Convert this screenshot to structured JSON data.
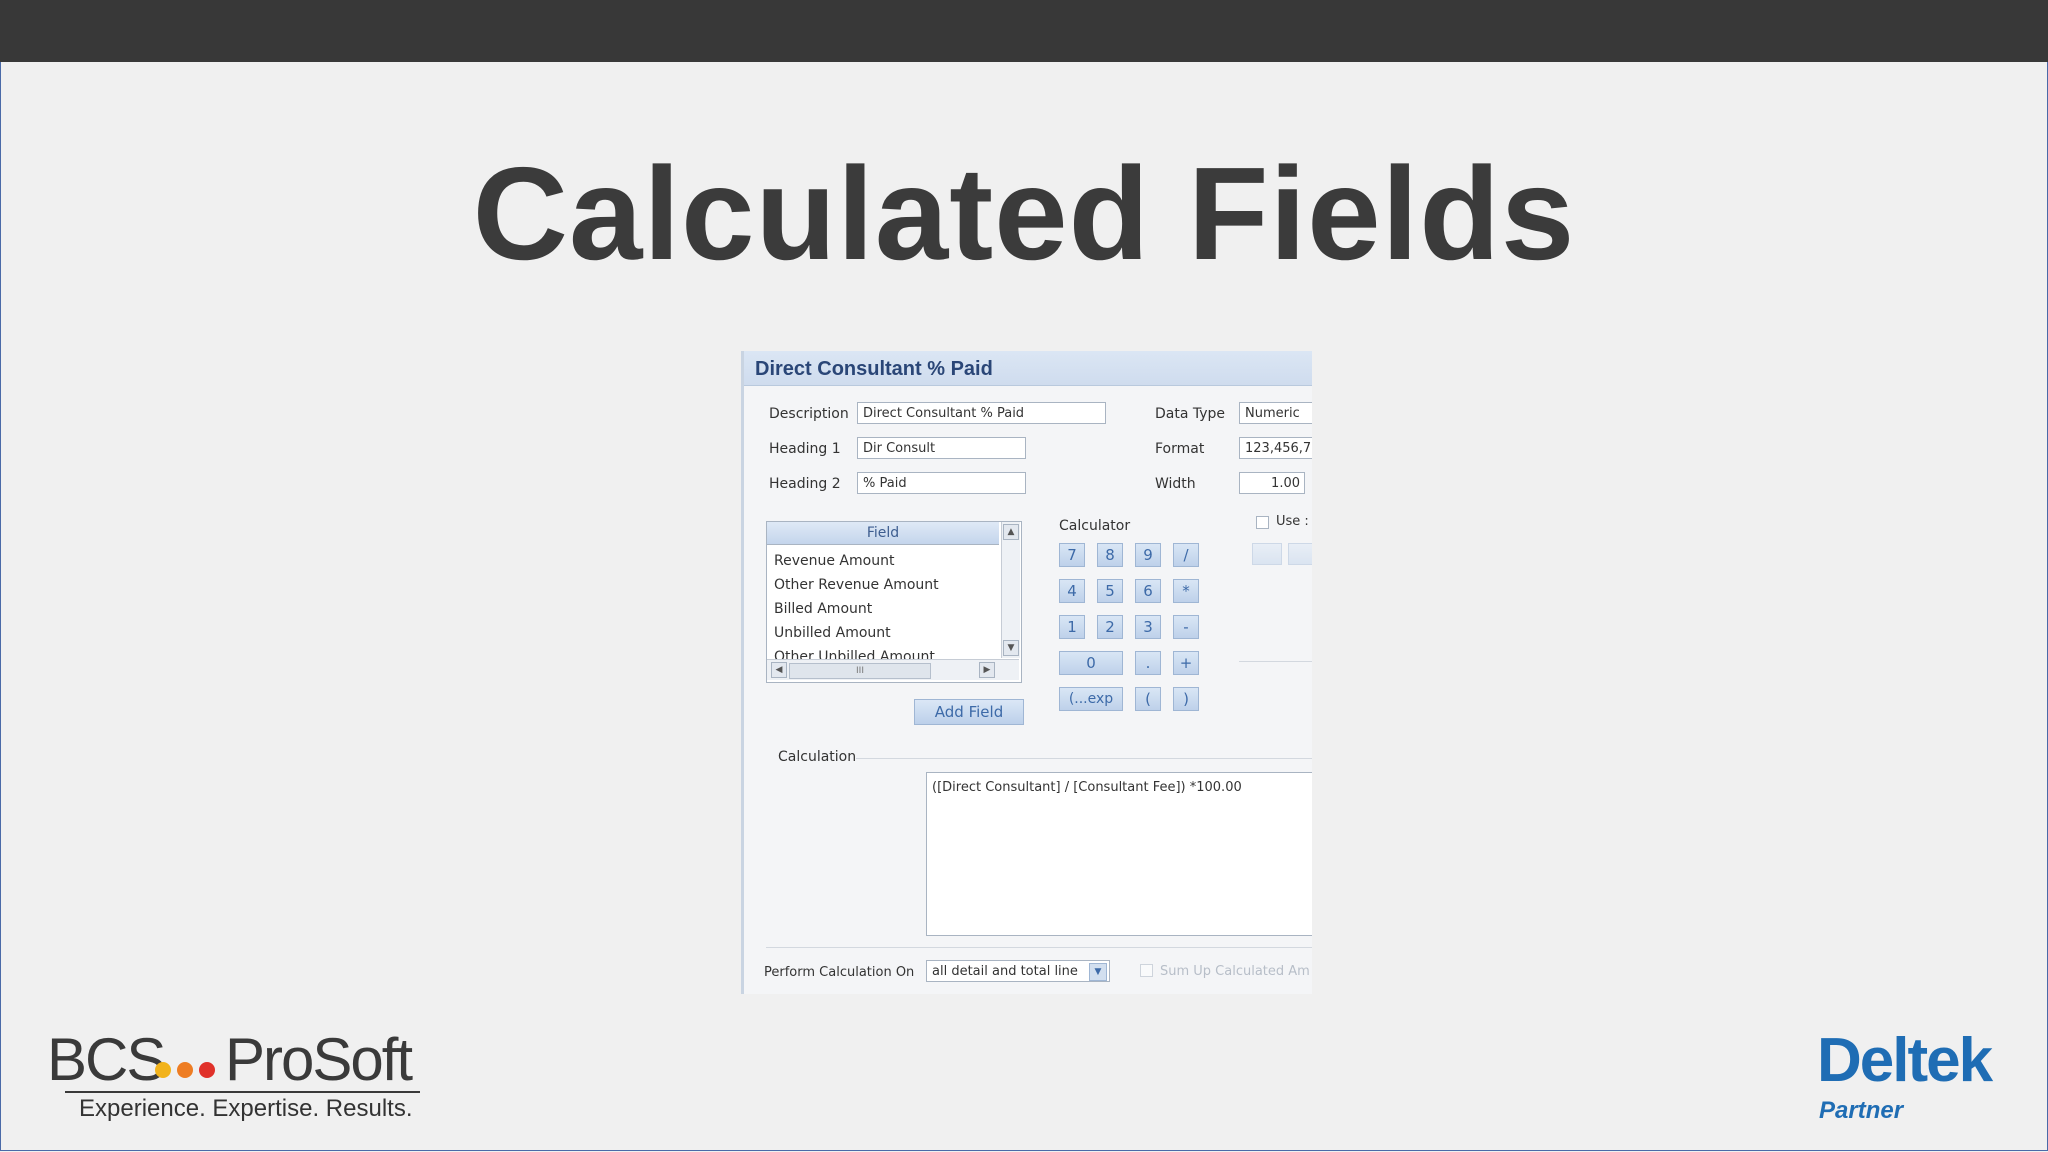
{
  "slide": {
    "title": "Calculated Fields"
  },
  "dialog": {
    "title": "Direct Consultant % Paid",
    "description_label": "Description",
    "description_value": "Direct Consultant % Paid",
    "heading1_label": "Heading 1",
    "heading1_value": "Dir Consult",
    "heading2_label": "Heading 2",
    "heading2_value": "% Paid",
    "data_type_label": "Data Type",
    "data_type_value": "Numeric",
    "format_label": "Format",
    "format_value": "123,456,7",
    "width_label": "Width",
    "width_value": "1.00",
    "use_label": "Use :",
    "field_list": {
      "header": "Field",
      "items": [
        "Revenue Amount",
        "Other Revenue Amount",
        "Billed Amount",
        "Unbilled Amount",
        "Other Unbilled Amount"
      ],
      "hscroll_grip": "III"
    },
    "add_field_label": "Add Field",
    "calculator": {
      "label": "Calculator",
      "keys": [
        "7",
        "8",
        "9",
        "/",
        "4",
        "5",
        "6",
        "*",
        "1",
        "2",
        "3",
        "-",
        "0",
        ".",
        "+",
        "(...exp",
        "(",
        ")"
      ]
    },
    "calculation_label": "Calculation",
    "calculation_value": "([Direct Consultant] / [Consultant Fee]) *100.00",
    "perform_label": "Perform Calculation On",
    "perform_value": "all detail and total line",
    "sum_up_label": "Sum Up Calculated Am"
  },
  "logos": {
    "bcs_left": "BCS",
    "bcs_right": "ProSoft",
    "bcs_tagline": "Experience. Expertise. Results.",
    "deltek": "Deltek",
    "deltek_sub": "Partner"
  },
  "colors": {
    "title": "#3b3b3b",
    "deltek_blue": "#1f6db4",
    "dot_yellow": "#f2b31b",
    "dot_orange": "#ee7d23",
    "dot_red": "#e0312a"
  }
}
